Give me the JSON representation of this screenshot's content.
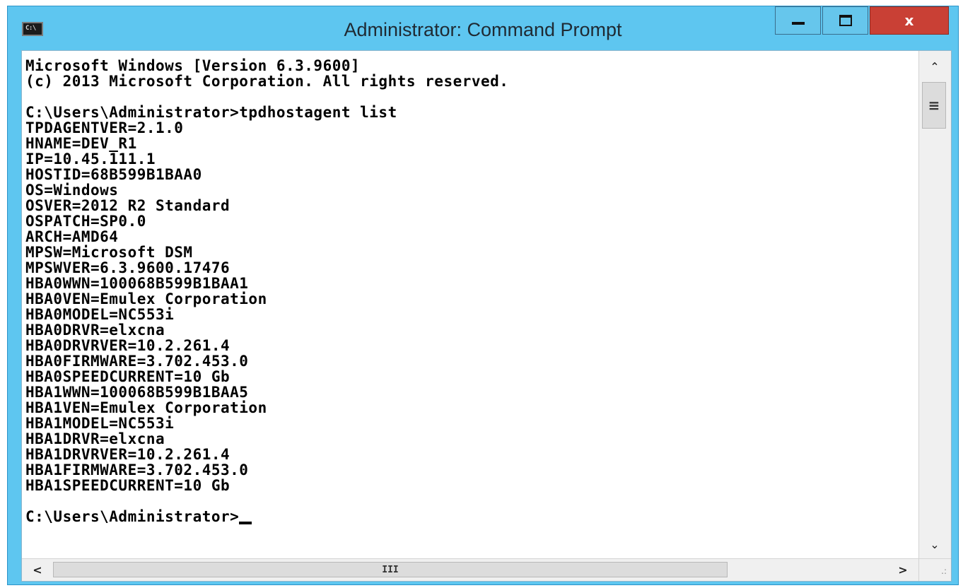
{
  "window": {
    "title": "Administrator: Command Prompt",
    "icon": "cmd-icon",
    "icon_text": "C:\\",
    "controls": {
      "minimize_icon": "minimize-icon",
      "maximize_icon": "maximize-icon",
      "close_icon": "close-icon",
      "close_glyph": "x"
    }
  },
  "console": {
    "lines": [
      "Microsoft Windows [Version 6.3.9600]",
      "(c) 2013 Microsoft Corporation. All rights reserved.",
      "",
      "C:\\Users\\Administrator>tpdhostagent list",
      "TPDAGENTVER=2.1.0",
      "HNAME=DEV_R1",
      "IP=10.45.111.1",
      "HOSTID=68B599B1BAA0",
      "OS=Windows",
      "OSVER=2012 R2 Standard",
      "OSPATCH=SP0.0",
      "ARCH=AMD64",
      "MPSW=Microsoft DSM",
      "MPSWVER=6.3.9600.17476",
      "HBA0WWN=100068B599B1BAA1",
      "HBA0VEN=Emulex Corporation",
      "HBA0MODEL=NC553i",
      "HBA0DRVR=elxcna",
      "HBA0DRVRVER=10.2.261.4",
      "HBA0FIRMWARE=3.702.453.0",
      "HBA0SPEEDCURRENT=10 Gb",
      "HBA1WWN=100068B599B1BAA5",
      "HBA1VEN=Emulex Corporation",
      "HBA1MODEL=NC553i",
      "HBA1DRVR=elxcna",
      "HBA1DRVRVER=10.2.261.4",
      "HBA1FIRMWARE=3.702.453.0",
      "HBA1SPEEDCURRENT=10 Gb",
      ""
    ],
    "prompt": "C:\\Users\\Administrator>"
  },
  "scrollbars": {
    "vertical": {
      "up_icon": "chevron-up-icon",
      "down_icon": "chevron-down-icon",
      "thumb_glyph": "≡",
      "up_glyph": "⌃",
      "down_glyph": "⌄"
    },
    "horizontal": {
      "left_icon": "chevron-left-icon",
      "right_icon": "chevron-right-icon",
      "thumb_glyph": "III",
      "left_glyph": "<",
      "right_glyph": ">"
    },
    "grip_glyph": ".:"
  }
}
